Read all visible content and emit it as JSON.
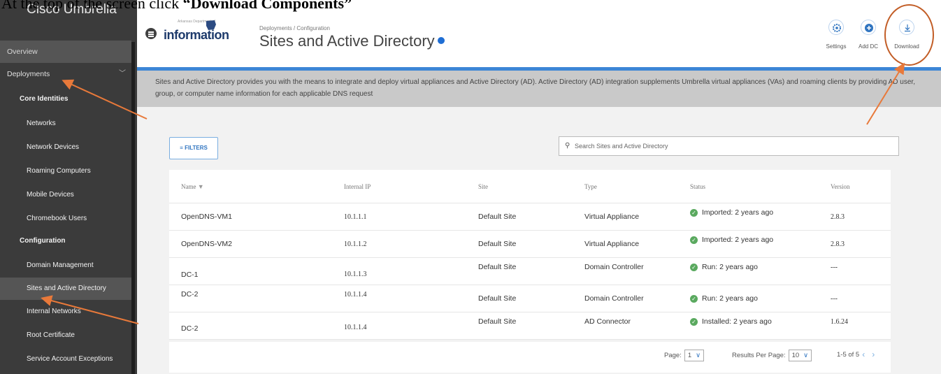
{
  "caption": {
    "prefix": "At the top of the screen click ",
    "bold": "“Download Components”"
  },
  "sidebar": {
    "brand": "Cisco Umbrella",
    "overview": "Overview",
    "deployments": "Deployments",
    "section_core": "Core Identities",
    "core_items": [
      "Networks",
      "Network Devices",
      "Roaming Computers",
      "Mobile Devices",
      "Chromebook Users"
    ],
    "section_config": "Configuration",
    "config_items": [
      "Domain Management",
      "Sites and Active Directory",
      "Internal Networks",
      "Root Certificate",
      "Service Account Exceptions"
    ]
  },
  "header": {
    "logo_word": "information",
    "logo_top": "Arkansas Department of",
    "breadcrumb": "Deployments / Configuration",
    "title": "Sites and Active Directory",
    "settings": "Settings",
    "add_dc": "Add DC",
    "download": "Download"
  },
  "banner": "Sites and Active Directory provides you with the means to integrate and deploy virtual appliances and Active Directory (AD). Active Directory (AD) integration supplements Umbrella virtual appliances (VAs) and roaming clients by providing AD user, group, or computer name information for each applicable DNS request",
  "filters_label": "FILTERS",
  "search_placeholder": "Search Sites and Active Directory",
  "table": {
    "headers": {
      "name": "Name",
      "ip": "Internal IP",
      "site": "Site",
      "type": "Type",
      "status": "Status",
      "version": "Version"
    },
    "rows": [
      {
        "name": "OpenDNS-VM1",
        "ip": "10.1.1.1",
        "site": "Default Site",
        "type": "Virtual Appliance",
        "status": "Imported: 2 years ago",
        "version": "2.8.3"
      },
      {
        "name": "OpenDNS-VM2",
        "ip": "10.1.1.2",
        "site": "Default Site",
        "type": "Virtual Appliance",
        "status": "Imported: 2 years ago",
        "version": "2.8.3"
      },
      {
        "name": "DC-1",
        "ip": "10.1.1.3",
        "site": "Default Site",
        "type": "Domain Controller",
        "status": "Run: 2 years ago",
        "version": "---"
      },
      {
        "name": "DC-2",
        "ip": "10.1.1.4",
        "site": "Default Site",
        "type": "Domain Controller",
        "status": "Run: 2 years ago",
        "version": "---"
      },
      {
        "name": "DC-2",
        "ip": "10.1.1.4",
        "site": "Default Site",
        "type": "AD Connector",
        "status": "Installed: 2 years ago",
        "version": "1.6.24"
      }
    ]
  },
  "pager": {
    "page_label": "Page:",
    "page": "1",
    "rpp_label": "Results Per Page:",
    "rpp": "10",
    "range": "1-5 of 5"
  },
  "colors": {
    "accent": "#3c86d6",
    "sidebar": "#3b3b3b",
    "annotation": "#e8793a",
    "status_ok": "#5aa95f"
  }
}
